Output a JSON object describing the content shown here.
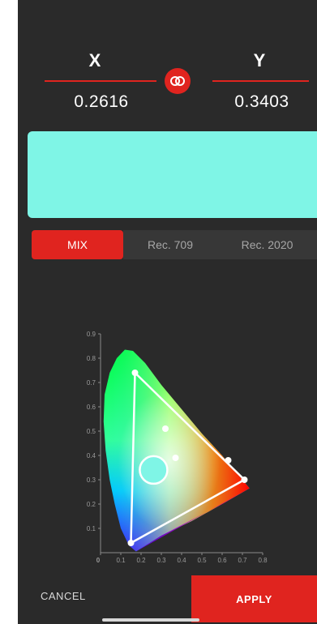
{
  "header": {
    "x_label": "X",
    "y_label": "Y",
    "x_value": "0.2616",
    "y_value": "0.3403",
    "link_icon": "linked-circles-icon"
  },
  "swatch": {
    "color": "#7ff5e6"
  },
  "modes": {
    "items": [
      {
        "label": "MIX",
        "active": true
      },
      {
        "label": "Rec. 709",
        "active": false
      },
      {
        "label": "Rec. 2020",
        "active": false
      }
    ]
  },
  "chart_data": {
    "type": "scatter",
    "title": "",
    "xlabel": "",
    "ylabel": "",
    "xlim": [
      0,
      0.8
    ],
    "ylim": [
      0,
      0.9
    ],
    "x_ticks": [
      "0",
      "0.1",
      "0.2",
      "0.3",
      "0.4",
      "0.5",
      "0.6",
      "0.7",
      "0.8"
    ],
    "y_ticks": [
      "0.1",
      "0.2",
      "0.3",
      "0.4",
      "0.5",
      "0.6",
      "0.7",
      "0.8",
      "0.9"
    ],
    "gamut_triangle": [
      {
        "x": 0.17,
        "y": 0.74
      },
      {
        "x": 0.71,
        "y": 0.3
      },
      {
        "x": 0.15,
        "y": 0.04
      }
    ],
    "points": [
      {
        "x": 0.32,
        "y": 0.51
      },
      {
        "x": 0.37,
        "y": 0.39
      },
      {
        "x": 0.63,
        "y": 0.38
      }
    ],
    "selected": {
      "x": 0.2616,
      "y": 0.3403
    }
  },
  "actions": {
    "cancel_label": "CANCEL",
    "apply_label": "APPLY"
  },
  "colors": {
    "accent": "#e0241f",
    "background": "#2a2a2a",
    "tab_inactive": "#373737"
  }
}
